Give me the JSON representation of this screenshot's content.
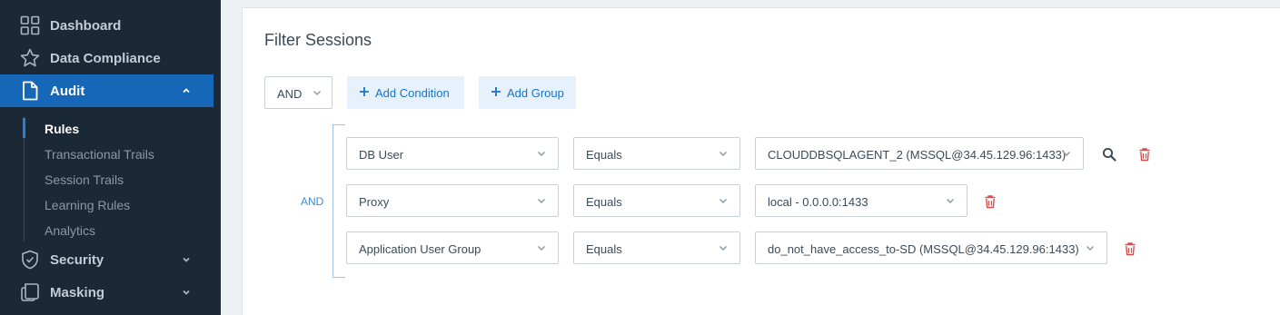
{
  "sidebar": {
    "items": [
      {
        "label": "Dashboard",
        "icon": "grid-icon"
      },
      {
        "label": "Data Compliance",
        "icon": "star-icon"
      },
      {
        "label": "Audit",
        "icon": "document-icon",
        "expanded": true,
        "active": true
      },
      {
        "label": "Security",
        "icon": "shield-icon"
      },
      {
        "label": "Masking",
        "icon": "masking-icon"
      }
    ],
    "audit_sub_items": [
      {
        "label": "Rules",
        "active": true
      },
      {
        "label": "Transactional Trails"
      },
      {
        "label": "Session Trails"
      },
      {
        "label": "Learning Rules"
      },
      {
        "label": "Analytics"
      }
    ]
  },
  "filter": {
    "title": "Filter Sessions",
    "root_operator": "AND",
    "add_condition_label": "Add Condition",
    "add_group_label": "Add Group",
    "group_operator": "AND",
    "conditions": [
      {
        "field": "DB User",
        "operator": "Equals",
        "value": "CLOUDDBSQLAGENT_2 (MSSQL@34.45.129.96:1433)",
        "has_search": true
      },
      {
        "field": "Proxy",
        "operator": "Equals",
        "value": "local - 0.0.0.0:1433",
        "has_search": false
      },
      {
        "field": "Application User Group",
        "operator": "Equals",
        "value": "do_not_have_access_to-SD (MSSQL@34.45.129.96:1433)",
        "has_search": false
      }
    ]
  },
  "colors": {
    "sidebar_bg": "#1b2835",
    "active_bg": "#1667b7",
    "accent": "#1a73c9",
    "delete": "#e0484a"
  }
}
